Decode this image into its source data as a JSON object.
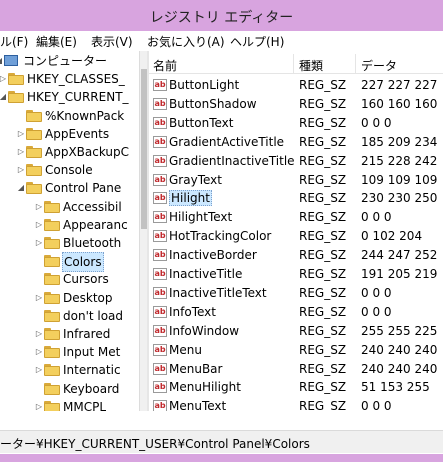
{
  "window": {
    "title": "レジストリ エディター"
  },
  "menu": [
    "ル(F)",
    "編集(E)",
    "表示(V)",
    "お気に入り(A)",
    "ヘルプ(H)"
  ],
  "tree": [
    {
      "label": "コンピューター",
      "level": 0,
      "arrow": "◢",
      "icon": "pc"
    },
    {
      "label": "HKEY_CLASSES_",
      "level": 1,
      "arrow": "▷",
      "icon": "folder"
    },
    {
      "label": "HKEY_CURRENT_",
      "level": 1,
      "arrow": "◢",
      "icon": "folder"
    },
    {
      "label": "%KnownPack",
      "level": 2,
      "arrow": "",
      "icon": "folder"
    },
    {
      "label": "AppEvents",
      "level": 2,
      "arrow": "▷",
      "icon": "folder"
    },
    {
      "label": "AppXBackupC",
      "level": 2,
      "arrow": "▷",
      "icon": "folder"
    },
    {
      "label": "Console",
      "level": 2,
      "arrow": "▷",
      "icon": "folder"
    },
    {
      "label": "Control Pane",
      "level": 2,
      "arrow": "◢",
      "icon": "folder"
    },
    {
      "label": "Accessibil",
      "level": 3,
      "arrow": "▷",
      "icon": "folder"
    },
    {
      "label": "Appearanc",
      "level": 3,
      "arrow": "▷",
      "icon": "folder"
    },
    {
      "label": "Bluetooth",
      "level": 3,
      "arrow": "▷",
      "icon": "folder"
    },
    {
      "label": "Colors",
      "level": 3,
      "arrow": "",
      "icon": "folder",
      "selected": true
    },
    {
      "label": "Cursors",
      "level": 3,
      "arrow": "",
      "icon": "folder"
    },
    {
      "label": "Desktop",
      "level": 3,
      "arrow": "▷",
      "icon": "folder"
    },
    {
      "label": "don't load",
      "level": 3,
      "arrow": "",
      "icon": "folder"
    },
    {
      "label": "Infrared",
      "level": 3,
      "arrow": "▷",
      "icon": "folder"
    },
    {
      "label": "Input Met",
      "level": 3,
      "arrow": "▷",
      "icon": "folder"
    },
    {
      "label": "Internatic",
      "level": 3,
      "arrow": "▷",
      "icon": "folder"
    },
    {
      "label": "Keyboard",
      "level": 3,
      "arrow": "",
      "icon": "folder"
    },
    {
      "label": "MMCPL",
      "level": 3,
      "arrow": "▷",
      "icon": "folder"
    }
  ],
  "list": {
    "headers": {
      "name": "名前",
      "type": "種類",
      "data": "データ"
    },
    "rows": [
      {
        "name": "ButtonLight",
        "type": "REG_SZ",
        "data": "227 227 227"
      },
      {
        "name": "ButtonShadow",
        "type": "REG_SZ",
        "data": "160 160 160"
      },
      {
        "name": "ButtonText",
        "type": "REG_SZ",
        "data": "0 0 0"
      },
      {
        "name": "GradientActiveTitle",
        "type": "REG_SZ",
        "data": "185 209 234"
      },
      {
        "name": "GradientInactiveTitle",
        "type": "REG_SZ",
        "data": "215 228 242"
      },
      {
        "name": "GrayText",
        "type": "REG_SZ",
        "data": "109 109 109"
      },
      {
        "name": "Hilight",
        "type": "REG_SZ",
        "data": "230 230 250",
        "selected": true
      },
      {
        "name": "HilightText",
        "type": "REG_SZ",
        "data": "0 0 0"
      },
      {
        "name": "HotTrackingColor",
        "type": "REG_SZ",
        "data": "0 102 204"
      },
      {
        "name": "InactiveBorder",
        "type": "REG_SZ",
        "data": "244 247 252"
      },
      {
        "name": "InactiveTitle",
        "type": "REG_SZ",
        "data": "191 205 219"
      },
      {
        "name": "InactiveTitleText",
        "type": "REG_SZ",
        "data": "0 0 0"
      },
      {
        "name": "InfoText",
        "type": "REG_SZ",
        "data": "0 0 0"
      },
      {
        "name": "InfoWindow",
        "type": "REG_SZ",
        "data": "255 255 225"
      },
      {
        "name": "Menu",
        "type": "REG_SZ",
        "data": "240 240 240"
      },
      {
        "name": "MenuBar",
        "type": "REG_SZ",
        "data": "240 240 240"
      },
      {
        "name": "MenuHilight",
        "type": "REG_SZ",
        "data": "51 153 255"
      },
      {
        "name": "MenuText",
        "type": "REG_SZ",
        "data": "0 0 0"
      }
    ]
  },
  "status": {
    "path": "ーター¥HKEY_CURRENT_USER¥Control Panel¥Colors"
  },
  "colors": {
    "chrome": "#d8a4df",
    "selection": "#cce8ff",
    "string_icon": "#c0282c"
  }
}
